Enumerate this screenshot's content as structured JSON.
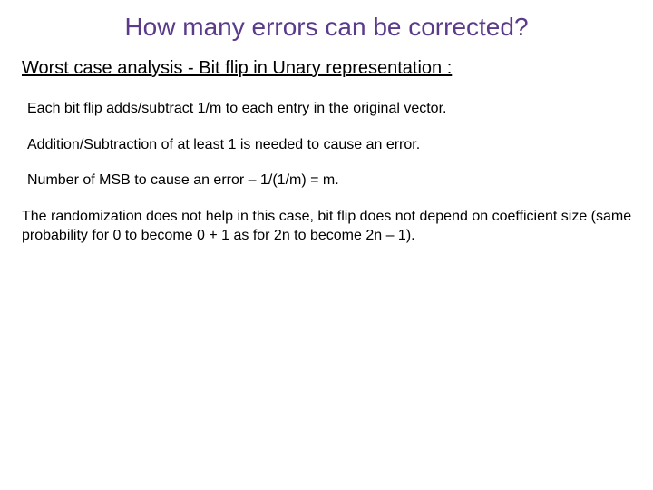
{
  "title": "How many errors can be corrected?",
  "subtitle": "Worst case analysis - Bit flip in Unary representation :",
  "p1": "Each bit flip adds/subtract 1/m to each entry in the original vector.",
  "p2": "Addition/Subtraction of at least 1 is needed to cause an error.",
  "p3": "Number of MSB to cause an error – 1/(1/m) = m.",
  "p4": "The randomization does not help in this case, bit flip does not depend on coefficient size (same probability for 0 to become 0 + 1 as for 2n to become 2n – 1)."
}
